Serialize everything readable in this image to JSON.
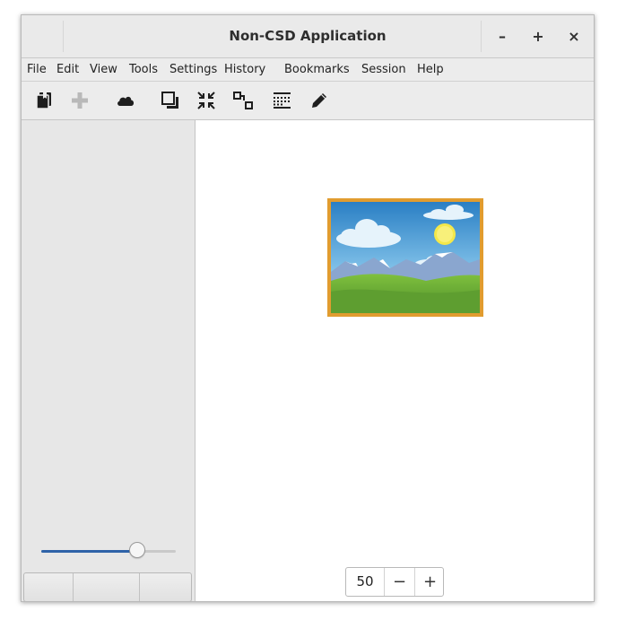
{
  "window": {
    "title": "Non-CSD Application",
    "controls": {
      "minimize": "–",
      "maximize": "+",
      "close": "×"
    }
  },
  "menubar": {
    "items": [
      "File",
      "Edit",
      "View",
      "Tools",
      "Settings",
      "History",
      "Bookmarks",
      "Session",
      "Help"
    ]
  },
  "toolbar": {
    "icons": [
      "bookmarks-icon",
      "add-icon",
      "cloud-icon",
      "copy-window-icon",
      "shrink-icon",
      "connect-nodes-icon",
      "table-icon",
      "edit-pencil-icon"
    ],
    "disabled": [
      "add-icon"
    ]
  },
  "sidebar": {
    "slider_value_fraction": 0.71,
    "accent_color": "#2f63a8"
  },
  "content": {
    "image_icon": "landscape-picture-icon",
    "zoom": {
      "value": "50",
      "decrement": "−",
      "increment": "+"
    }
  }
}
